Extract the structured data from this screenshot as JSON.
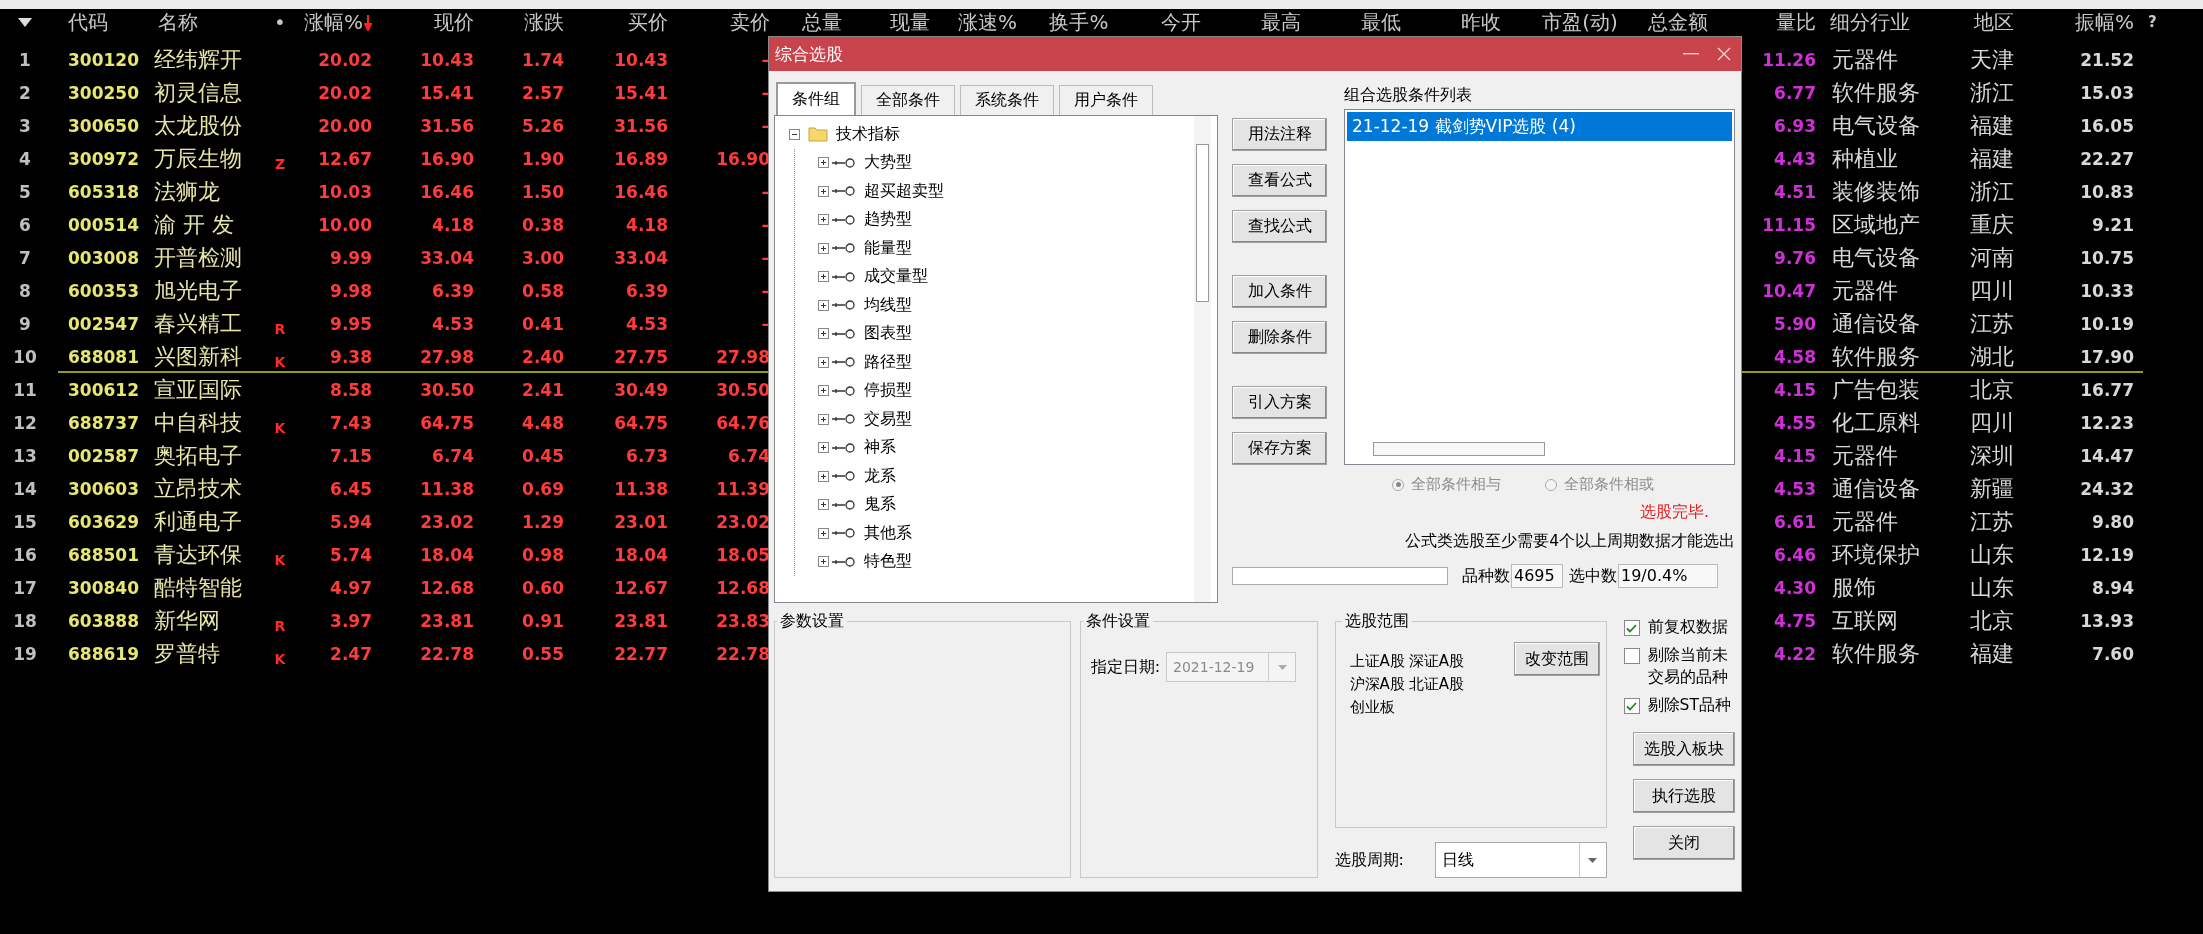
{
  "table": {
    "columns": [
      {
        "label": "代码",
        "sorted_desc": false
      },
      {
        "label": "名称",
        "sorted_desc": false
      },
      {
        "label": "•",
        "sorted_desc": false
      },
      {
        "label": "涨幅%",
        "sorted_desc": true
      },
      {
        "label": "现价",
        "sorted_desc": false
      },
      {
        "label": "涨跌",
        "sorted_desc": false
      },
      {
        "label": "买价",
        "sorted_desc": false
      },
      {
        "label": "卖价",
        "sorted_desc": false
      },
      {
        "label": "总量",
        "sorted_desc": false
      },
      {
        "label": "现量",
        "sorted_desc": false
      },
      {
        "label": "涨速%",
        "sorted_desc": false
      },
      {
        "label": "换手%",
        "sorted_desc": false
      },
      {
        "label": "今开",
        "sorted_desc": false
      },
      {
        "label": "最高",
        "sorted_desc": false
      },
      {
        "label": "最低",
        "sorted_desc": false
      },
      {
        "label": "昨收",
        "sorted_desc": false
      },
      {
        "label": "市盈(动)",
        "sorted_desc": false
      },
      {
        "label": "总金额",
        "sorted_desc": false
      },
      {
        "label": "量比",
        "sorted_desc": false
      },
      {
        "label": "细分行业",
        "sorted_desc": false
      },
      {
        "label": "地区",
        "sorted_desc": false
      },
      {
        "label": "振幅%",
        "sorted_desc": false
      },
      {
        "label": "?",
        "sorted_desc": false
      }
    ],
    "rows": [
      {
        "no": "1",
        "code": "300120",
        "name": "经纬辉开",
        "change_pct": "20.02",
        "price": "10.43",
        "change": "1.74",
        "bid": "10.43",
        "ask": "–",
        "volume_ratio": "11.26",
        "industry": "元器件",
        "region": "天津",
        "amplitude": "21.52",
        "separator_below": false
      },
      {
        "no": "2",
        "code": "300250",
        "name": "初灵信息",
        "change_pct": "20.02",
        "price": "15.41",
        "change": "2.57",
        "bid": "15.41",
        "ask": "–",
        "volume_ratio": "6.77",
        "industry": "软件服务",
        "region": "浙江",
        "amplitude": "15.03",
        "separator_below": false
      },
      {
        "no": "3",
        "code": "300650",
        "name": "太龙股份",
        "change_pct": "20.00",
        "price": "31.56",
        "change": "5.26",
        "bid": "31.56",
        "ask": "–",
        "volume_ratio": "6.93",
        "industry": "电气设备",
        "region": "福建",
        "amplitude": "16.05",
        "separator_below": false
      },
      {
        "no": "4",
        "code": "300972",
        "name": "万辰生物",
        "mark": "Z",
        "change_pct": "12.67",
        "price": "16.90",
        "change": "1.90",
        "bid": "16.89",
        "ask": "16.90",
        "volume_ratio": "4.43",
        "industry": "种植业",
        "region": "福建",
        "amplitude": "22.27",
        "separator_below": false
      },
      {
        "no": "5",
        "code": "605318",
        "name": "法狮龙",
        "change_pct": "10.03",
        "price": "16.46",
        "change": "1.50",
        "bid": "16.46",
        "ask": "–",
        "volume_ratio": "4.51",
        "industry": "装修装饰",
        "region": "浙江",
        "amplitude": "10.83",
        "separator_below": false
      },
      {
        "no": "6",
        "code": "000514",
        "name": "渝 开 发",
        "change_pct": "10.00",
        "price": "4.18",
        "change": "0.38",
        "bid": "4.18",
        "ask": "–",
        "volume_ratio": "11.15",
        "industry": "区域地产",
        "region": "重庆",
        "amplitude": "9.21",
        "separator_below": false
      },
      {
        "no": "7",
        "code": "003008",
        "name": "开普检测",
        "change_pct": "9.99",
        "price": "33.04",
        "change": "3.00",
        "bid": "33.04",
        "ask": "–",
        "volume_ratio": "9.76",
        "industry": "电气设备",
        "region": "河南",
        "amplitude": "10.75",
        "separator_below": false
      },
      {
        "no": "8",
        "code": "600353",
        "name": "旭光电子",
        "change_pct": "9.98",
        "price": "6.39",
        "change": "0.58",
        "bid": "6.39",
        "ask": "–",
        "volume_ratio": "10.47",
        "industry": "元器件",
        "region": "四川",
        "amplitude": "10.33",
        "separator_below": false
      },
      {
        "no": "9",
        "code": "002547",
        "name": "春兴精工",
        "mark": "R",
        "change_pct": "9.95",
        "price": "4.53",
        "change": "0.41",
        "bid": "4.53",
        "ask": "–",
        "volume_ratio": "5.90",
        "industry": "通信设备",
        "region": "江苏",
        "amplitude": "10.19",
        "separator_below": false
      },
      {
        "no": "10",
        "code": "688081",
        "name": "兴图新科",
        "mark": "K",
        "change_pct": "9.38",
        "price": "27.98",
        "change": "2.40",
        "bid": "27.75",
        "ask": "27.98",
        "volume_ratio": "4.58",
        "industry": "软件服务",
        "region": "湖北",
        "amplitude": "17.90",
        "separator_below": true
      },
      {
        "no": "11",
        "code": "300612",
        "name": "宣亚国际",
        "change_pct": "8.58",
        "price": "30.50",
        "change": "2.41",
        "bid": "30.49",
        "ask": "30.50",
        "volume_ratio": "4.15",
        "industry": "广告包装",
        "region": "北京",
        "amplitude": "16.77",
        "separator_below": false
      },
      {
        "no": "12",
        "code": "688737",
        "name": "中自科技",
        "mark": "K",
        "change_pct": "7.43",
        "price": "64.75",
        "change": "4.48",
        "bid": "64.75",
        "ask": "64.76",
        "volume_ratio": "4.55",
        "industry": "化工原料",
        "region": "四川",
        "amplitude": "12.23",
        "separator_below": false
      },
      {
        "no": "13",
        "code": "002587",
        "name": "奥拓电子",
        "change_pct": "7.15",
        "price": "6.74",
        "change": "0.45",
        "bid": "6.73",
        "ask": "6.74",
        "volume_ratio": "4.15",
        "industry": "元器件",
        "region": "深圳",
        "amplitude": "14.47",
        "separator_below": false
      },
      {
        "no": "14",
        "code": "300603",
        "name": "立昂技术",
        "change_pct": "6.45",
        "price": "11.38",
        "change": "0.69",
        "bid": "11.38",
        "ask": "11.39",
        "volume_ratio": "4.53",
        "industry": "通信设备",
        "region": "新疆",
        "amplitude": "24.32",
        "separator_below": false
      },
      {
        "no": "15",
        "code": "603629",
        "name": "利通电子",
        "change_pct": "5.94",
        "price": "23.02",
        "change": "1.29",
        "bid": "23.01",
        "ask": "23.02",
        "volume_ratio": "6.61",
        "industry": "元器件",
        "region": "江苏",
        "amplitude": "9.80",
        "separator_below": false
      },
      {
        "no": "16",
        "code": "688501",
        "name": "青达环保",
        "mark": "K",
        "change_pct": "5.74",
        "price": "18.04",
        "change": "0.98",
        "bid": "18.04",
        "ask": "18.05",
        "volume_ratio": "6.46",
        "industry": "环境保护",
        "region": "山东",
        "amplitude": "12.19",
        "separator_below": false
      },
      {
        "no": "17",
        "code": "300840",
        "name": "酷特智能",
        "change_pct": "4.97",
        "price": "12.68",
        "change": "0.60",
        "bid": "12.67",
        "ask": "12.68",
        "volume_ratio": "4.30",
        "industry": "服饰",
        "region": "山东",
        "amplitude": "8.94",
        "separator_below": false
      },
      {
        "no": "18",
        "code": "603888",
        "name": "新华网",
        "mark": "R",
        "change_pct": "3.97",
        "price": "23.81",
        "change": "0.91",
        "bid": "23.81",
        "ask": "23.83",
        "volume_ratio": "4.75",
        "industry": "互联网",
        "region": "北京",
        "amplitude": "13.93",
        "separator_below": false
      },
      {
        "no": "19",
        "code": "688619",
        "name": "罗普特",
        "mark": "K",
        "change_pct": "2.47",
        "price": "22.78",
        "change": "0.55",
        "bid": "22.77",
        "ask": "22.78",
        "volume_ratio": "4.22",
        "industry": "软件服务",
        "region": "福建",
        "amplitude": "7.60",
        "separator_below": false
      }
    ]
  },
  "dialog": {
    "title": "综合选股",
    "tabs": [
      {
        "label": "条件组",
        "selected": true
      },
      {
        "label": "全部条件",
        "selected": false
      },
      {
        "label": "系统条件",
        "selected": false
      },
      {
        "label": "用户条件",
        "selected": false
      }
    ],
    "tree": {
      "label": "技术指标",
      "expanded": true,
      "children": [
        {
          "label": "大势型",
          "expanded": false
        },
        {
          "label": "超买超卖型",
          "expanded": false
        },
        {
          "label": "趋势型",
          "expanded": false
        },
        {
          "label": "能量型",
          "expanded": false
        },
        {
          "label": "成交量型",
          "expanded": false
        },
        {
          "label": "均线型",
          "expanded": false
        },
        {
          "label": "图表型",
          "expanded": false
        },
        {
          "label": "路径型",
          "expanded": false
        },
        {
          "label": "停损型",
          "expanded": false
        },
        {
          "label": "交易型",
          "expanded": false
        },
        {
          "label": "神系",
          "expanded": false
        },
        {
          "label": "龙系",
          "expanded": false
        },
        {
          "label": "鬼系",
          "expanded": false
        },
        {
          "label": "其他系",
          "expanded": false
        },
        {
          "label": "特色型",
          "expanded": false
        }
      ]
    },
    "button_groups": [
      [
        "用法注释",
        "查看公式",
        "查找公式"
      ],
      [
        "加入条件",
        "删除条件"
      ],
      [
        "引入方案",
        "保存方案"
      ]
    ],
    "condition_list": {
      "title": "组合选股条件列表",
      "items": [
        {
          "label": "21-12-19 截剑势VIP选股 (4)",
          "selected": true
        }
      ]
    },
    "logic": {
      "disabled": true,
      "options": [
        {
          "label": "全部条件相与",
          "selected": true
        },
        {
          "label": "全部条件相或",
          "selected": false
        }
      ]
    },
    "status": "选股完毕.",
    "note": "公式类选股至少需要4个以上周期数据才能选出",
    "progress": {
      "level": 0
    },
    "stock_count": {
      "label": "品种数",
      "value": "4695"
    },
    "selected_count": {
      "label": "选中数",
      "value": "19/0.4%"
    },
    "param_group": {
      "title": "参数设置"
    },
    "condition_group": {
      "title": "条件设置",
      "date_label": "指定日期:",
      "date_value": "2021-12-19",
      "disabled": true
    },
    "range_group": {
      "title": "选股范围",
      "markets": [
        "上证A股",
        "深证A股",
        "沪深A股",
        "北证A股",
        "创业板"
      ],
      "button": "改变范围"
    },
    "period": {
      "label": "选股周期:",
      "value": "日线"
    },
    "options": [
      {
        "label": "前复权数据",
        "checked": true
      },
      {
        "label": "剔除当前未交易的品种",
        "checked": false
      },
      {
        "label": "剔除ST品种",
        "checked": true
      }
    ],
    "action_buttons": [
      "选股入板块",
      "执行选股",
      "关闭"
    ]
  }
}
